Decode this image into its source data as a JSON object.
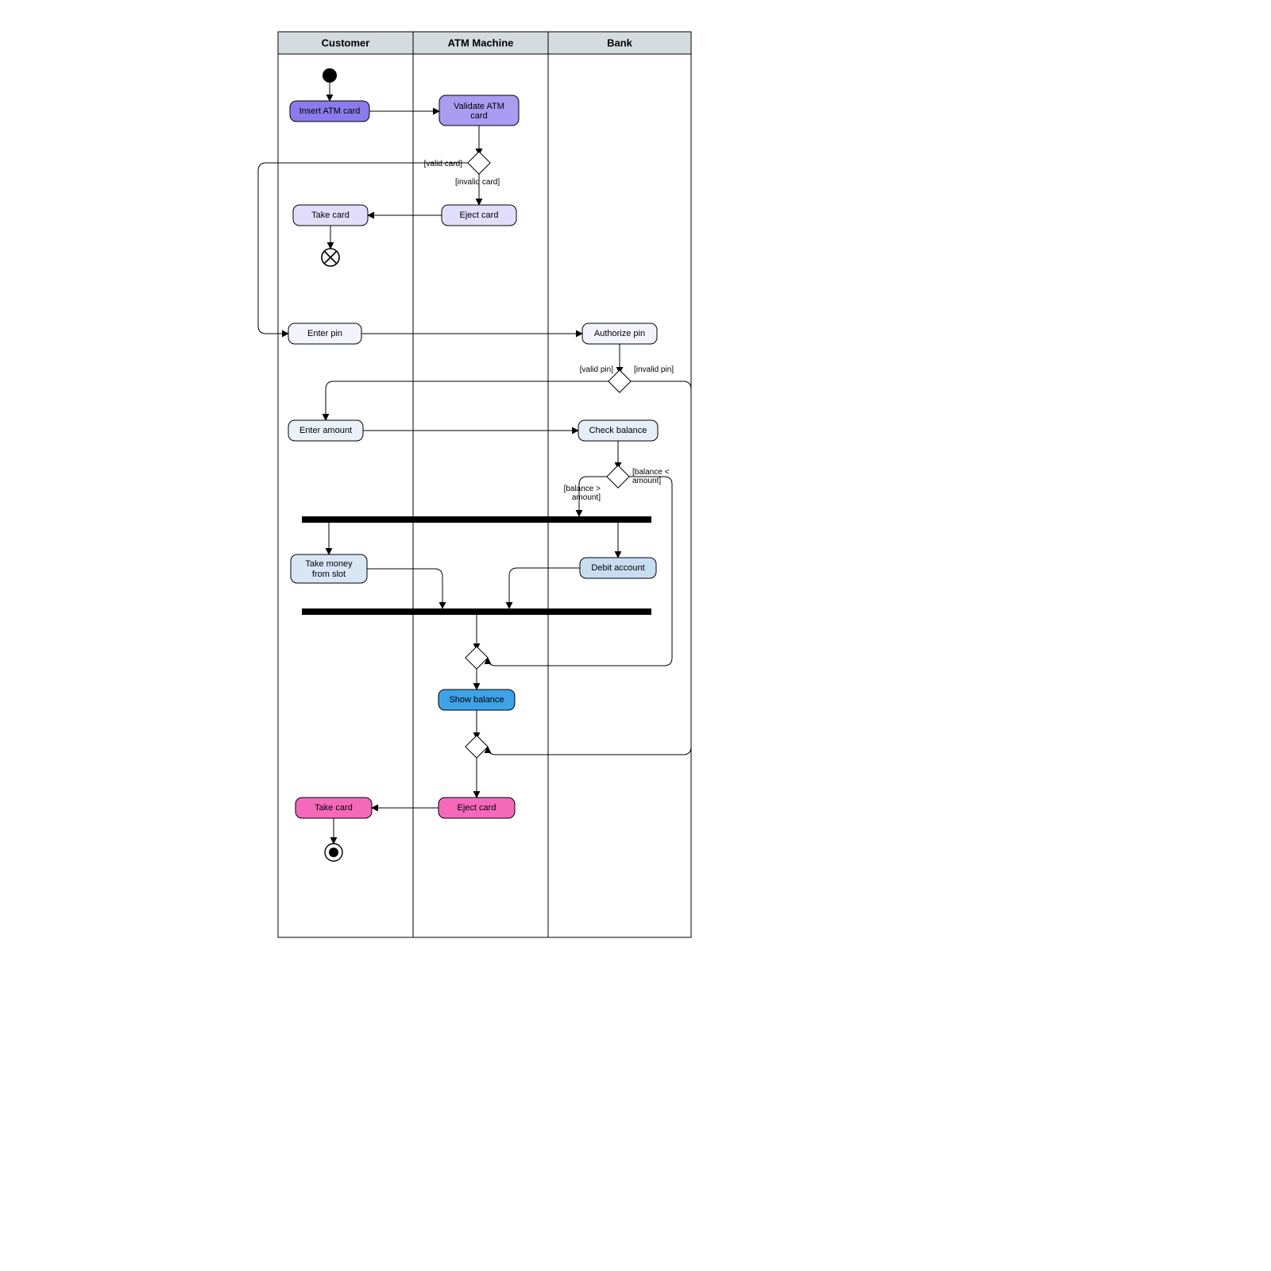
{
  "lanes": {
    "customer": "Customer",
    "atm": "ATM Machine",
    "bank": "Bank"
  },
  "activities": {
    "insertCard": "Insert ATM card",
    "validateCard": "Validate ATM card",
    "validateCardL2": "",
    "ejectCard1": "Eject card",
    "takeCard1": "Take card",
    "enterPin": "Enter pin",
    "authorizePin": "Authorize pin",
    "enterAmount": "Enter amount",
    "checkBalance": "Check balance",
    "takeMoney": "Take money",
    "takeMoneyL2": "from slot",
    "debitAccount": "Debit account",
    "showBalance": "Show balance",
    "ejectCard2": "Eject card",
    "takeCard2": "Take card"
  },
  "guards": {
    "validCard": "[valid card]",
    "invalidCard": "[invalid card]",
    "validPin": "[valid pin]",
    "invalidPin": "[invalid pin]",
    "balanceGt": "[balance > amount]",
    "balanceGtL1": "[balance >",
    "balanceGtL2": "amount]",
    "balanceLt": "[balance < amount]",
    "balanceLtL1": "[balance <",
    "balanceLtL2": "amount]"
  },
  "colors": {
    "purpleFill": "#8b7bec",
    "purpleLightFill": "#a99cf1",
    "lavenderFill": "#e0defb",
    "iceFill": "#f2f3fd",
    "paleBlueFill": "#eaf1fa",
    "paleBlueFill2": "#e6eef9",
    "lightBlueFill": "#d9e6f6",
    "skyBlueFill": "#c9ddf2",
    "blueFill": "#3da3e6",
    "pinkFill": "#f569bb"
  }
}
